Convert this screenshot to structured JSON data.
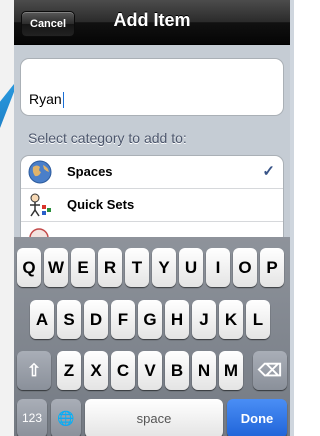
{
  "navbar": {
    "title": "Add Item",
    "cancel_label": "Cancel"
  },
  "form": {
    "name_value": "Ryan"
  },
  "category": {
    "heading": "Select category to add to:",
    "items": [
      {
        "label": "Spaces",
        "icon": "globe-icon",
        "selected": true
      },
      {
        "label": "Quick Sets",
        "icon": "quick-sets-icon",
        "selected": false
      }
    ],
    "check_glyph": "✓"
  },
  "keyboard": {
    "row1": [
      "Q",
      "W",
      "E",
      "R",
      "T",
      "Y",
      "U",
      "I",
      "O",
      "P"
    ],
    "row2": [
      "A",
      "S",
      "D",
      "F",
      "G",
      "H",
      "J",
      "K",
      "L"
    ],
    "row3": [
      "Z",
      "X",
      "C",
      "V",
      "B",
      "N",
      "M"
    ],
    "shift_glyph": "⇧",
    "delete_glyph": "⌫",
    "numbers_label": "123",
    "globe_glyph": "🌐",
    "space_label": "space",
    "done_label": "Done"
  },
  "colors": {
    "accent": "#1f63d8",
    "callout": "#1d7fc6",
    "check": "#385487"
  }
}
